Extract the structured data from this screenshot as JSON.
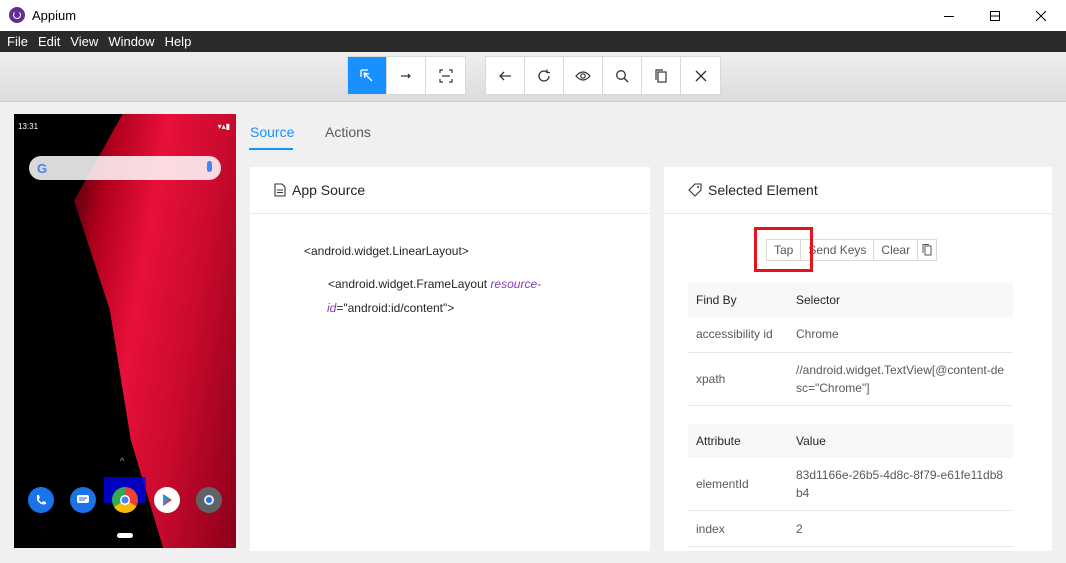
{
  "window": {
    "title": "Appium"
  },
  "menu": [
    "File",
    "Edit",
    "View",
    "Window",
    "Help"
  ],
  "phone": {
    "time": "13:31"
  },
  "tabs": {
    "source": "Source",
    "actions": "Actions"
  },
  "app_source": {
    "title": "App Source",
    "root": "<android.widget.LinearLayout>",
    "child_tag": "<android.widget.FrameLayout",
    "child_attr_name": "resource-",
    "child_attr_name2": "id",
    "child_attr_value": "=\"android:id/content\">"
  },
  "selected_element": {
    "title": "Selected Element",
    "buttons": {
      "tap": "Tap",
      "send_keys": "Send Keys",
      "clear": "Clear"
    },
    "find_by_header": {
      "find_by": "Find By",
      "selector": "Selector"
    },
    "find_by_rows": [
      {
        "find_by": "accessibility id",
        "selector": "Chrome"
      },
      {
        "find_by": "xpath",
        "selector": "//android.widget.TextView[@content-desc=\"Chrome\"]"
      }
    ],
    "attr_header": {
      "attribute": "Attribute",
      "value": "Value"
    },
    "attr_rows": [
      {
        "attribute": "elementId",
        "value": "83d1166e-26b5-4d8c-8f79-e61fe11db8b4"
      },
      {
        "attribute": "index",
        "value": "2"
      }
    ]
  },
  "colors": {
    "accent": "#1890ff",
    "menu_bg": "#2b2b2b",
    "highlight": "#e8131e"
  }
}
